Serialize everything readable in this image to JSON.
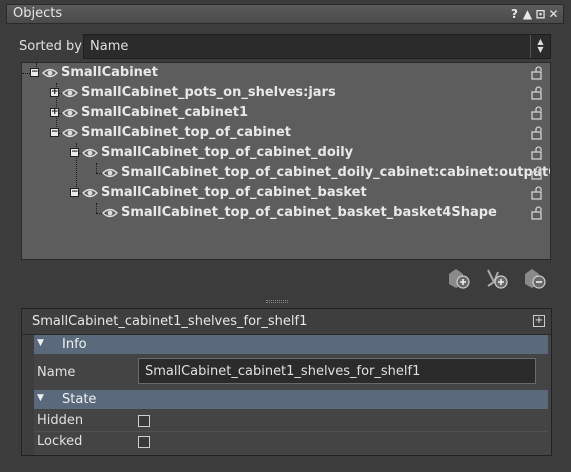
{
  "panel": {
    "title": "Objects",
    "controls": [
      "?",
      "▲",
      "⊡",
      "✕"
    ]
  },
  "sort": {
    "label": "Sorted by",
    "value": "Name"
  },
  "tree": {
    "items": [
      {
        "label": "SmallCabinet",
        "expander": "−"
      },
      {
        "label": "SmallCabinet_pots_on_shelves:jars",
        "expander": "+"
      },
      {
        "label": "SmallCabinet_cabinet1",
        "expander": "+"
      },
      {
        "label": "SmallCabinet_top_of_cabinet",
        "expander": "−"
      },
      {
        "label": "SmallCabinet_top_of_cabinet_doily",
        "expander": "−"
      },
      {
        "label": "SmallCabinet_top_of_cabinet_doily_cabinet:cabinet:outputClot",
        "expander": ""
      },
      {
        "label": "SmallCabinet_top_of_cabinet_basket",
        "expander": "−"
      },
      {
        "label": "SmallCabinet_top_of_cabinet_basket_basket4Shape",
        "expander": ""
      }
    ]
  },
  "toolbar": {
    "icons": [
      "add-object-icon",
      "add-child-icon",
      "remove-object-icon"
    ]
  },
  "attributes": {
    "object_name": "SmallCabinet_cabinet1_shelves_for_shelf1",
    "add_label": "+",
    "info": {
      "title": "Info",
      "name_label": "Name",
      "name_value": "SmallCabinet_cabinet1_shelves_for_shelf1"
    },
    "state": {
      "title": "State",
      "hidden_label": "Hidden",
      "locked_label": "Locked",
      "hidden": false,
      "locked": false
    }
  },
  "colors": {
    "tree_bg": "#5d5d5d",
    "section_bg": "#5a6a7c",
    "panel_bg": "#3c3c3c"
  }
}
